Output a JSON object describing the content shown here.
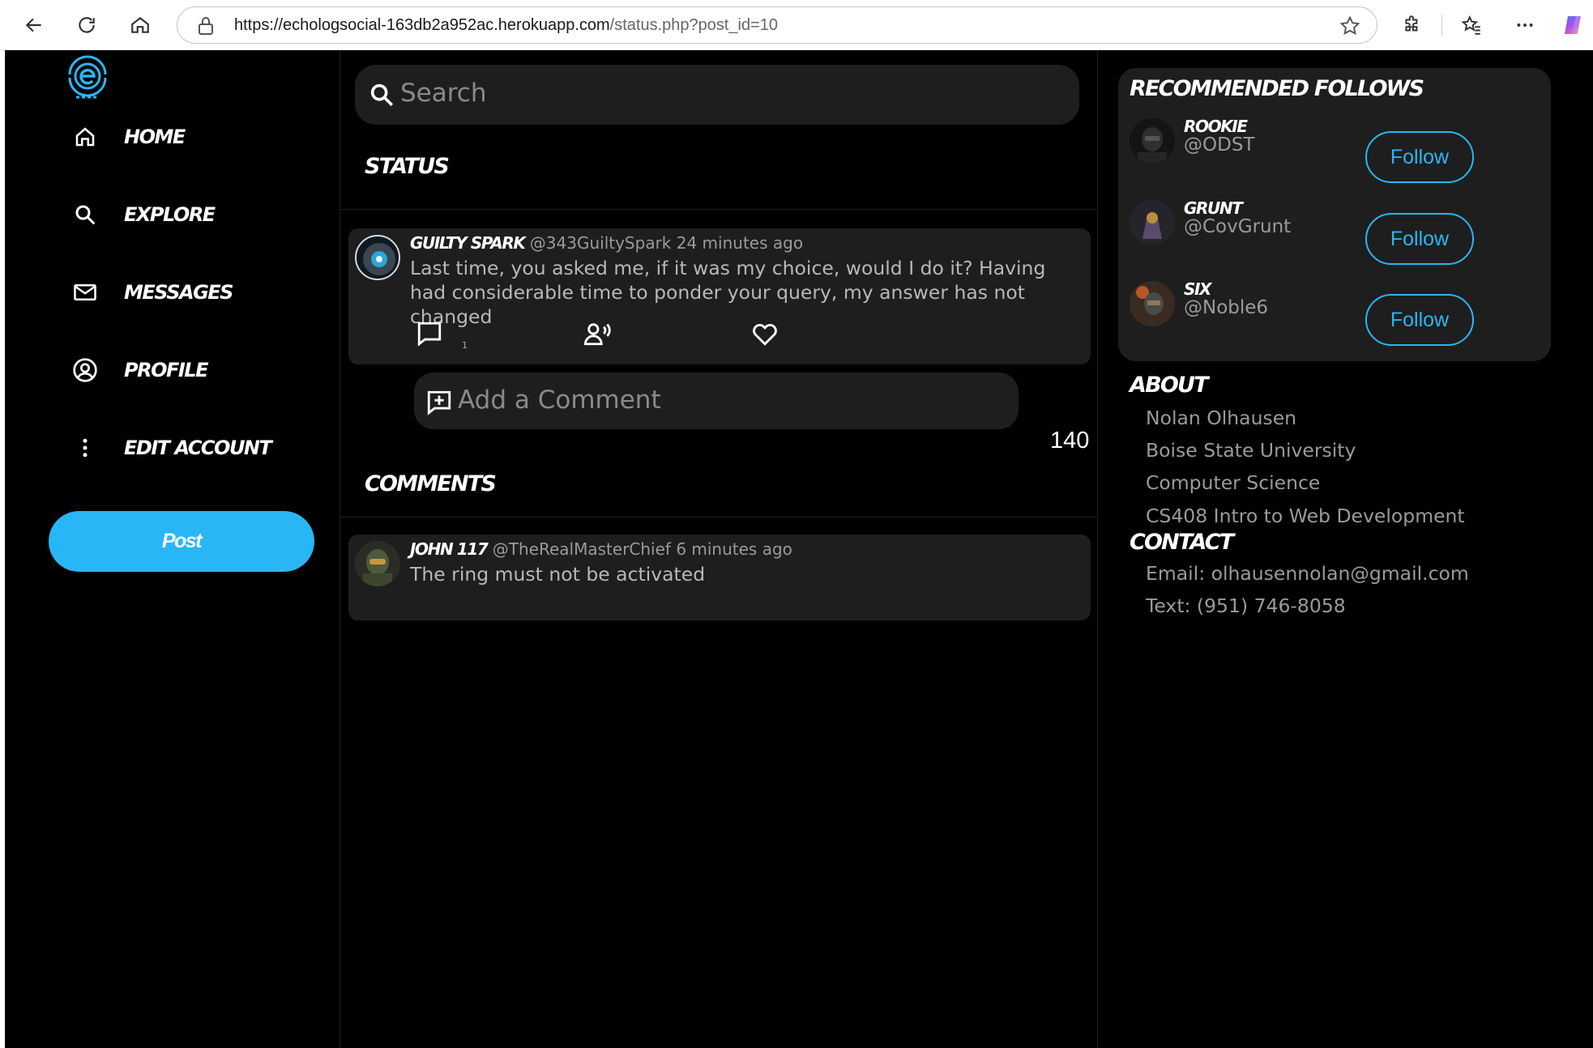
{
  "browser": {
    "url_host": "https://echologsocial-163db2a952ac.herokuapp.com",
    "url_path": "/status.php?post_id=10"
  },
  "colors": {
    "accent": "#29b6f6",
    "background": "#000000",
    "card": "#1e1e1e"
  },
  "sidebar": {
    "logo_icon": "echo-e-logo",
    "items": [
      {
        "label": "Home",
        "icon": "home-icon"
      },
      {
        "label": "Explore",
        "icon": "search-icon"
      },
      {
        "label": "Messages",
        "icon": "mail-icon"
      },
      {
        "label": "Profile",
        "icon": "profile-icon"
      },
      {
        "label": "Edit Account",
        "icon": "more-vertical-icon"
      }
    ],
    "post_label": "Post"
  },
  "main": {
    "search_placeholder": "Search",
    "status_title": "Status",
    "post": {
      "author": "Guilty Spark",
      "handle": "@343GuiltySpark",
      "time": "24 minutes ago",
      "text": "Last time, you asked me, if it was my choice, would I do it? Having had considerable time to ponder your query, my answer has not changed",
      "comment_count": "1"
    },
    "comment_placeholder": "Add a Comment",
    "char_count": "140",
    "comments_title": "Comments",
    "comments": [
      {
        "author": "John 117",
        "handle": "@TheRealMasterChief",
        "time": "6 minutes ago",
        "text": "The ring must not be activated"
      }
    ]
  },
  "right": {
    "rec_title": "Recommended Follows",
    "follow_label": "Follow",
    "recommended": [
      {
        "name": "Rookie",
        "handle": "@ODST"
      },
      {
        "name": "Grunt",
        "handle": "@CovGrunt"
      },
      {
        "name": "Six",
        "handle": "@Noble6"
      }
    ],
    "about_title": "About",
    "about_lines": [
      "Nolan Olhausen",
      "Boise State University",
      "Computer Science",
      "CS408 Intro to Web Development"
    ],
    "contact_title": "Contact",
    "contact_lines": [
      "Email: olhausennolan@gmail.com",
      "Text: (951) 746-8058"
    ]
  }
}
